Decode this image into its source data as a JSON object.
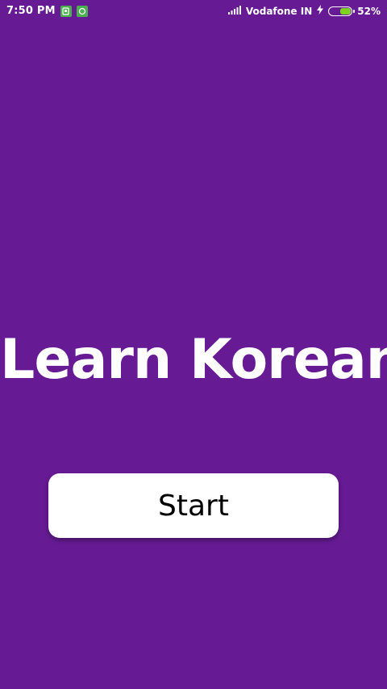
{
  "status_bar": {
    "time": "7:50 PM",
    "carrier": "Vodafone IN",
    "battery_percent": "52%",
    "battery_level": 0.52,
    "icons": [
      "sim-notification-icon",
      "app-notification-icon",
      "signal-icon",
      "charging-icon",
      "battery-icon"
    ]
  },
  "main": {
    "title": "Learn Korean",
    "start_label": "Start"
  },
  "colors": {
    "background": "#661b94",
    "button": "#ffffff",
    "text_on_background": "#ffffff",
    "button_text": "#000000",
    "battery_fill": "#7ed321",
    "notification_icon": "#4caf50"
  }
}
